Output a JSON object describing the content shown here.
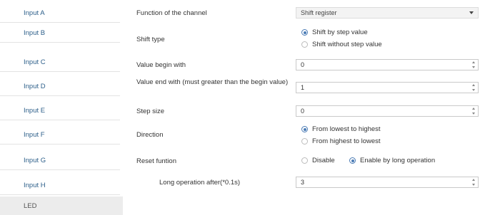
{
  "sidebar": {
    "items": [
      {
        "label": "Input A"
      },
      {
        "label": "Input B"
      },
      {
        "label": "Input C"
      },
      {
        "label": "Input D"
      },
      {
        "label": "Input E"
      },
      {
        "label": "Input F"
      },
      {
        "label": "Input G"
      },
      {
        "label": "Input H"
      },
      {
        "label": "LED"
      }
    ]
  },
  "form": {
    "function": {
      "label": "Function of the channel",
      "value": "Shift register"
    },
    "shift_type": {
      "label": "Shift type",
      "options": [
        "Shift by step value",
        "Shift without step value"
      ],
      "selected": "Shift by step value"
    },
    "begin": {
      "label": "Value begin with",
      "value": "0"
    },
    "end": {
      "label": "Value end with (must greater than the begin value)",
      "value": "1"
    },
    "step": {
      "label": "Step size",
      "value": "0"
    },
    "direction": {
      "label": "Direction",
      "options": [
        "From lowest to highest",
        "From highest to lowest"
      ],
      "selected": "From lowest to highest"
    },
    "reset": {
      "label": "Reset funtion",
      "options": [
        "Disable",
        "Enable by long operation"
      ],
      "selected": "Enable by long operation"
    },
    "long_op": {
      "label": "Long operation after(*0.1s)",
      "value": "3"
    }
  },
  "colors": {
    "sidebar_text": "#2d5f8a",
    "radio_accent": "#4a7bb5",
    "selected_item_bg": "#ececec"
  }
}
